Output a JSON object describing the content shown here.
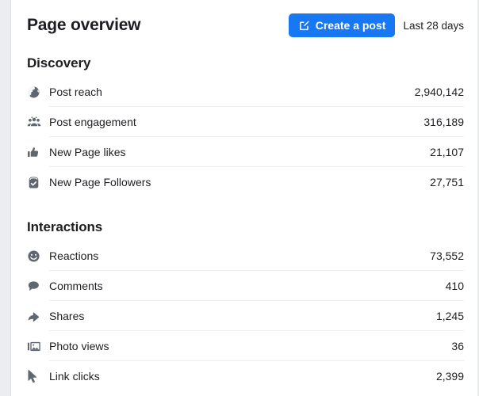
{
  "header": {
    "title": "Page overview",
    "create_post_label": "Create a post",
    "create_post_icon": "compose-icon",
    "date_range": "Last 28 days",
    "accent_color": "#1877f2"
  },
  "sections": [
    {
      "title": "Discovery",
      "rows": [
        {
          "icon": "globe-icon",
          "label": "Post reach",
          "value": "2,940,142"
        },
        {
          "icon": "people-icon",
          "label": "Post engagement",
          "value": "316,189"
        },
        {
          "icon": "thumbs-up-icon",
          "label": "New Page likes",
          "value": "21,107"
        },
        {
          "icon": "follower-check-icon",
          "label": "New Page Followers",
          "value": "27,751"
        }
      ]
    },
    {
      "title": "Interactions",
      "rows": [
        {
          "icon": "smiley-icon",
          "label": "Reactions",
          "value": "73,552"
        },
        {
          "icon": "speech-bubble-icon",
          "label": "Comments",
          "value": "410"
        },
        {
          "icon": "share-arrow-icon",
          "label": "Shares",
          "value": "1,245"
        },
        {
          "icon": "photo-icon",
          "label": "Photo views",
          "value": "36"
        },
        {
          "icon": "cursor-icon",
          "label": "Link clicks",
          "value": "2,399"
        }
      ]
    }
  ],
  "colors": {
    "icon_gray": "#606770",
    "text_primary": "#1c1e21",
    "divider": "#edeef1",
    "gutter": "#ebedf0"
  }
}
